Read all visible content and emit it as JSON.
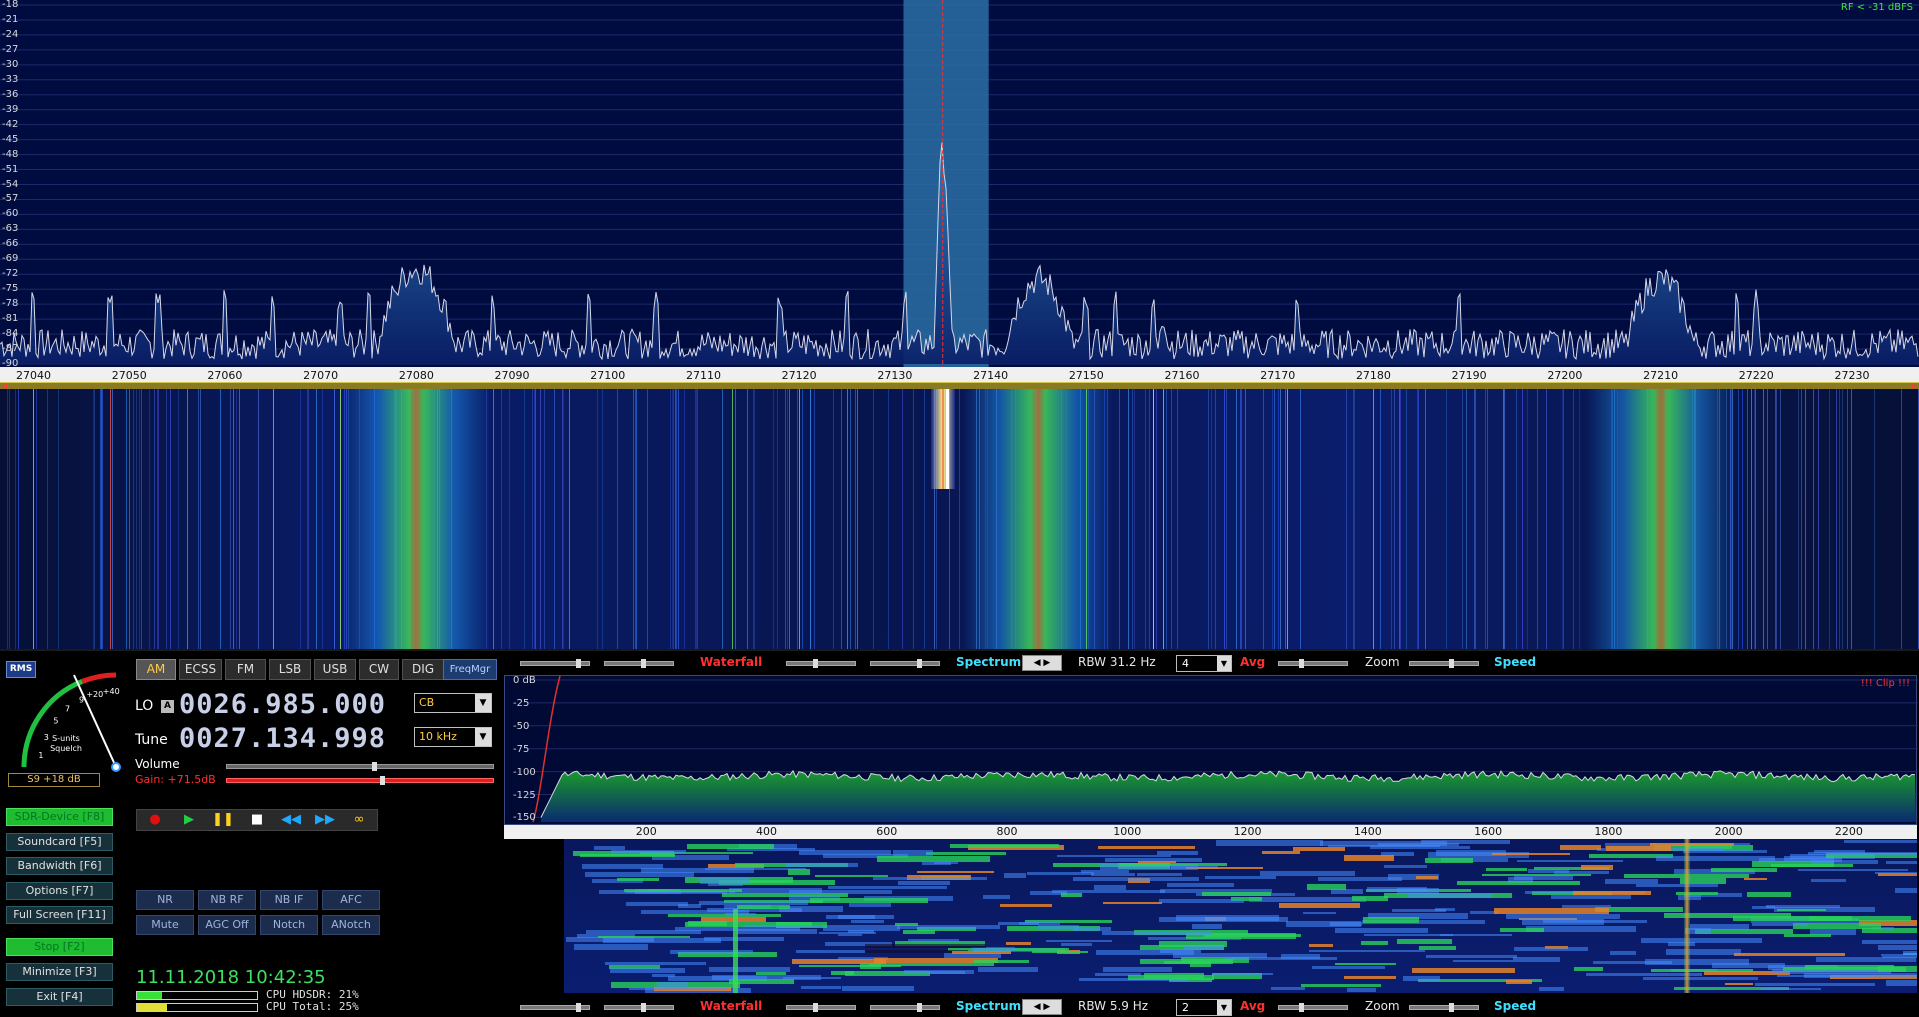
{
  "spectrum": {
    "db_labels": [
      "-18",
      "-21",
      "-24",
      "-27",
      "-30",
      "-33",
      "-36",
      "-39",
      "-42",
      "-45",
      "-48",
      "-51",
      "-54",
      "-57",
      "-60",
      "-63",
      "-66",
      "-69",
      "-72",
      "-75",
      "-78",
      "-81",
      "-84",
      "-87",
      "-90"
    ],
    "rf_level": "RF < -31 dBFS",
    "freq_labels": [
      "27040",
      "27050",
      "27060",
      "27070",
      "27080",
      "27090",
      "27100",
      "27110",
      "27120",
      "27130",
      "27140",
      "27150",
      "27160",
      "27170",
      "27180",
      "27190",
      "27200",
      "27210",
      "27220",
      "27230"
    ],
    "freq_range_khz": [
      27036.5,
      27237
    ],
    "passband_khz": [
      27130.9,
      27139.8
    ],
    "tuned_khz": 27135.0,
    "db_range": [
      -90,
      -18
    ],
    "peaks": [
      {
        "f": 27080,
        "db": -71,
        "w": 2.6
      },
      {
        "f": 27145,
        "db": -73,
        "w": 2.4
      },
      {
        "f": 27210,
        "db": -73,
        "w": 2.4
      },
      {
        "f": 27135,
        "db": -48,
        "w": 0.35
      },
      {
        "f": 27158,
        "db": -80,
        "w": 0.5
      }
    ],
    "spurs_khz": [
      27040,
      27048,
      27053,
      27060,
      27065,
      27072,
      27075,
      27078,
      27088,
      27098,
      27105,
      27118,
      27125,
      27131,
      27150,
      27153,
      27157,
      27172,
      27189,
      27218,
      27220
    ]
  },
  "waterfall": {
    "bands_khz": [
      27080,
      27145,
      27210
    ],
    "lines": [
      {
        "f": 27040,
        "color": "#6dd26d"
      },
      {
        "f": 27048,
        "color": "#e05050"
      },
      {
        "f": 27056,
        "color": "#e05050"
      },
      {
        "f": 27065,
        "color": "#5fd05f"
      },
      {
        "f": 27072,
        "color": "#9fe07f"
      },
      {
        "f": 27088,
        "color": "#e05050"
      },
      {
        "f": 27096,
        "color": "#e05050"
      },
      {
        "f": 27113,
        "color": "#5fd05f"
      },
      {
        "f": 27120,
        "color": "#5fd05f"
      },
      {
        "f": 27125,
        "color": "#e05050"
      },
      {
        "f": 27150,
        "color": "#5fd05f"
      },
      {
        "f": 27157,
        "color": "#e0e060"
      },
      {
        "f": 27158,
        "color": "#e0a060"
      },
      {
        "f": 27171,
        "color": "#6dd26d"
      },
      {
        "f": 27180,
        "color": "#6aa0ff"
      }
    ]
  },
  "smeter": {
    "rms_label": "RMS",
    "ticks": [
      "1",
      "3",
      "5",
      "7",
      "9",
      "+20",
      "+40"
    ],
    "caption1": "S-units",
    "caption2": "Squelch",
    "readout": "S9 +18 dB"
  },
  "modes": {
    "items": [
      "AM",
      "ECSS",
      "FM",
      "LSB",
      "USB",
      "CW",
      "DIG"
    ],
    "active": "AM",
    "freqmgr": "FreqMgr"
  },
  "lo": {
    "label": "LO",
    "badge": "A",
    "value": "0026.985.000",
    "band": "CB"
  },
  "tune": {
    "label": "Tune",
    "value": "0027.134.998",
    "step": "10 kHz"
  },
  "volume": {
    "label": "Volume",
    "level": 0.55
  },
  "gain": {
    "label": "Gain: +71.5dB",
    "level": 0.58
  },
  "side_buttons": [
    {
      "label": "SDR-Device [F8]",
      "green": true
    },
    {
      "label": "Soundcard  [F5]",
      "green": false
    },
    {
      "label": "Bandwidth  [F6]",
      "green": false
    },
    {
      "label": "Options    [F7]",
      "green": false
    },
    {
      "label": "Full Screen [F11]",
      "green": false
    },
    {
      "label": "Stop        [F2]",
      "green": true
    },
    {
      "label": "Minimize  [F3]",
      "green": false
    },
    {
      "label": "Exit        [F4]",
      "green": false
    }
  ],
  "transport": [
    {
      "icon": "record-icon",
      "glyph": "●",
      "color": "#e01010"
    },
    {
      "icon": "play-icon",
      "glyph": "▶",
      "color": "#20d040"
    },
    {
      "icon": "pause-icon",
      "glyph": "❚❚",
      "color": "#ffd020"
    },
    {
      "icon": "stop-icon",
      "glyph": "■",
      "color": "#ffffff"
    },
    {
      "icon": "rewind-icon",
      "glyph": "◀◀",
      "color": "#20a8ff"
    },
    {
      "icon": "fast-forward-icon",
      "glyph": "▶▶",
      "color": "#20a8ff"
    },
    {
      "icon": "loop-icon",
      "glyph": "∞",
      "color": "#ffd020"
    }
  ],
  "dsp": {
    "row1": [
      "NR",
      "NB RF",
      "NB IF",
      "AFC"
    ],
    "row2": [
      "Mute",
      "AGC Off",
      "Notch",
      "ANotch"
    ]
  },
  "datetime": "11.11.2018 10:42:35",
  "cpu": {
    "hdsdr_label": "CPU HDSDR:  21%",
    "hdsdr_pct": 21,
    "total_label": "CPU Total:  25%",
    "total_pct": 25
  },
  "audio_top_bar": {
    "waterfall": "Waterfall",
    "spectrum": "Spectrum",
    "rbw": "RBW  31.2 Hz",
    "avg_value": "4",
    "avg": "Avg",
    "zoom": "Zoom",
    "speed": "Speed"
  },
  "audio_bottom_bar": {
    "waterfall": "Waterfall",
    "spectrum": "Spectrum",
    "rbw": "RBW   5.9 Hz",
    "avg_value": "2",
    "avg": "Avg",
    "zoom": "Zoom",
    "speed": "Speed"
  },
  "audio_spectrum": {
    "db_labels": [
      "0 dB",
      "-25",
      "-50",
      "-75",
      "-100",
      "-125",
      "-150"
    ],
    "clip": "!!! Clip !!!",
    "freq_labels": [
      "200",
      "400",
      "600",
      "800",
      "1000",
      "1200",
      "1400",
      "1600",
      "1800",
      "2000",
      "2200"
    ],
    "freq_range_hz": [
      0,
      2300
    ],
    "db_range": [
      -155,
      0
    ],
    "floor_db": -105
  },
  "colors": {
    "spectrum_bg": "#000c40",
    "passband": "#2a6fa5",
    "trace": "#d8d8e8",
    "fill_top": "#1e4a8c",
    "tuned_line": "#ff2a2a"
  }
}
